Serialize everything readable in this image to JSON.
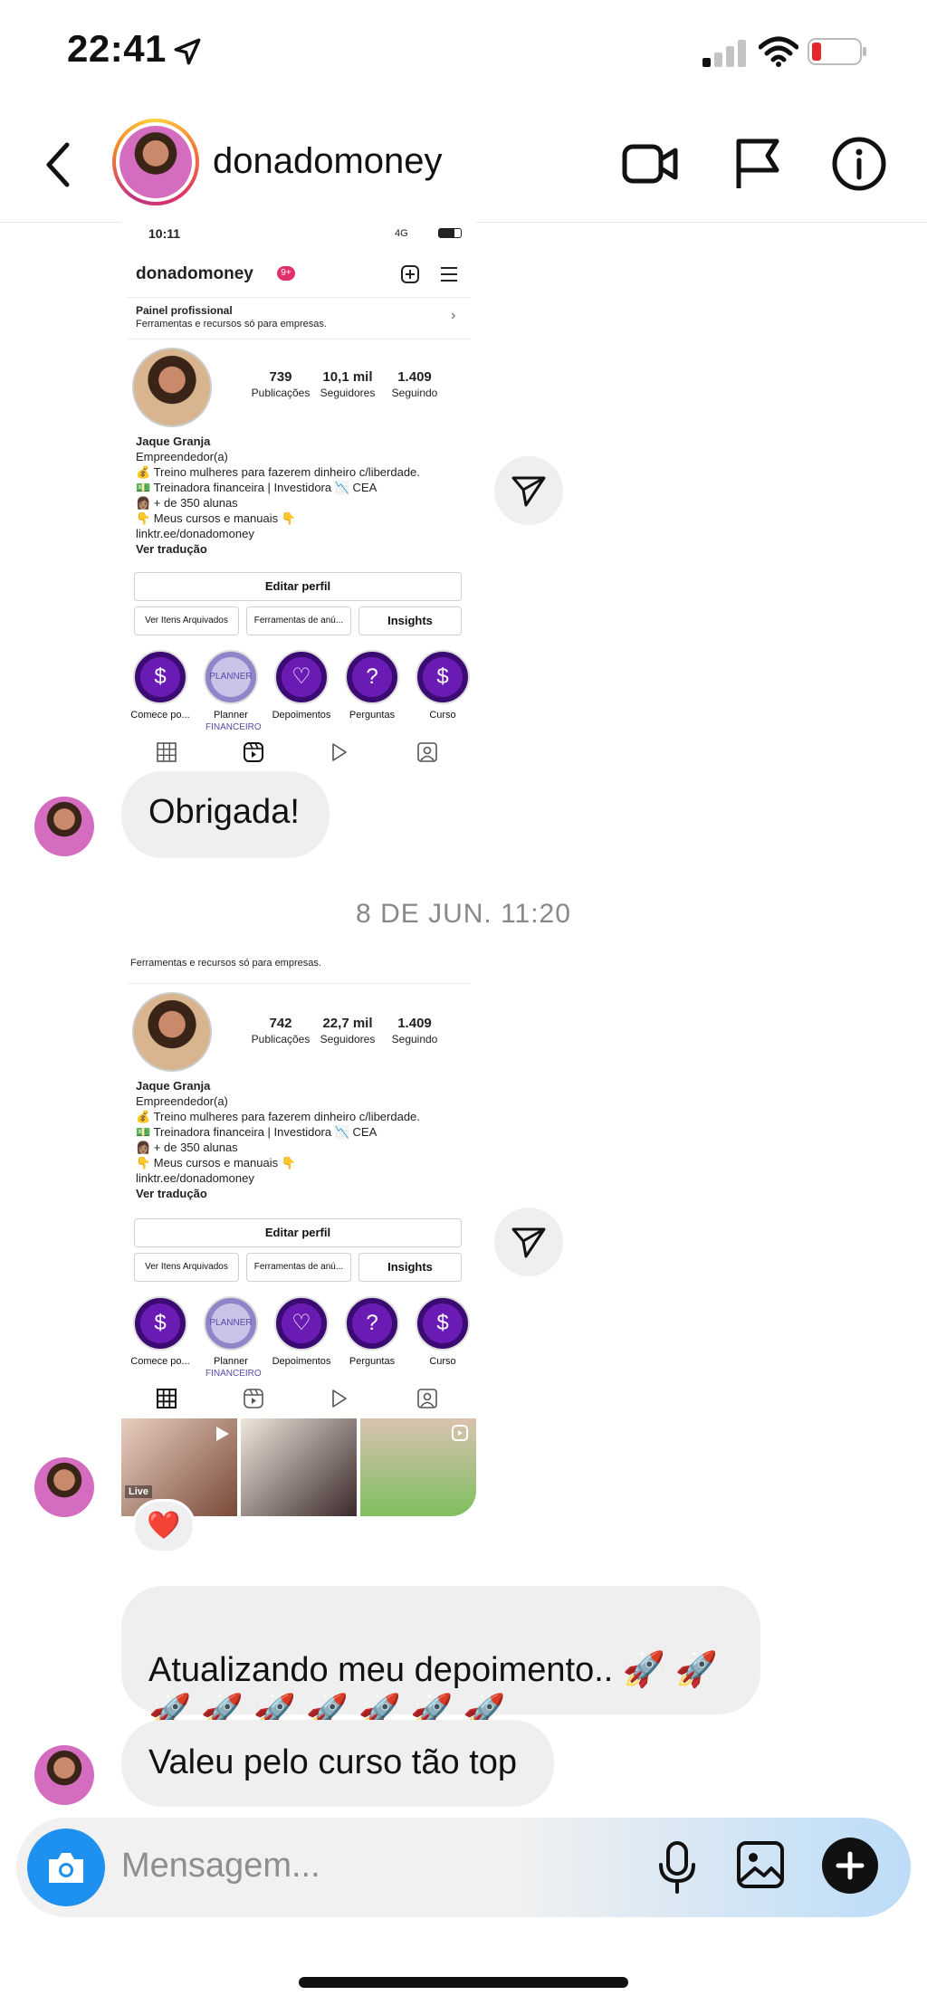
{
  "status": {
    "time": "22:41"
  },
  "header": {
    "username": "donadomoney"
  },
  "card1": {
    "time": "10:11",
    "network": "4G",
    "username": "donadomoney",
    "badge": "9+",
    "panel_title": "Painel profissional",
    "panel_sub": "Ferramentas e recursos só para empresas.",
    "stats": [
      {
        "value": "739",
        "label": "Publicações"
      },
      {
        "value": "10,1 mil",
        "label": "Seguidores"
      },
      {
        "value": "1.409",
        "label": "Seguindo"
      }
    ]
  },
  "card2": {
    "panel_sub": "Ferramentas e recursos só para empresas.",
    "stats": [
      {
        "value": "742",
        "label": "Publicações"
      },
      {
        "value": "22,7 mil",
        "label": "Seguidores"
      },
      {
        "value": "1.409",
        "label": "Seguindo"
      }
    ],
    "thumb_live": "Live"
  },
  "profile": {
    "name": "Jaque Granja",
    "category": "Empreendedor(a)",
    "bio": [
      "💰 Treino mulheres para fazerem dinheiro c/liberdade.",
      "💵 Treinadora financeira | Investidora 📉 CEA",
      "👩🏽 + de 350 alunas",
      "👇 Meus cursos e manuais 👇"
    ],
    "link": "linktr.ee/donadomoney",
    "translate": "Ver tradução",
    "edit_btn": "Editar perfil",
    "archived_btn": "Ver Itens Arquivados",
    "tools_btn": "Ferramentas de anú...",
    "insights_btn": "Insights",
    "highlights": [
      "Comece po...",
      "Planner",
      "Depoimentos",
      "Perguntas",
      "Curso"
    ],
    "planner_text": "PLANNER FINANCEIRO"
  },
  "messages": {
    "m1": "Obrigada!",
    "date": "8 DE JUN. 11:20",
    "reaction": "❤️",
    "m2": "Atualizando meu depoimento.. 🚀 🚀\n🚀 🚀 🚀 🚀 🚀 🚀 🚀",
    "m3": "Valeu pelo curso tão top"
  },
  "composer": {
    "placeholder": "Mensagem..."
  },
  "colors": {
    "camera": "#1e90ef",
    "bubble": "#efefef",
    "highlight": "#6a1bb3"
  }
}
